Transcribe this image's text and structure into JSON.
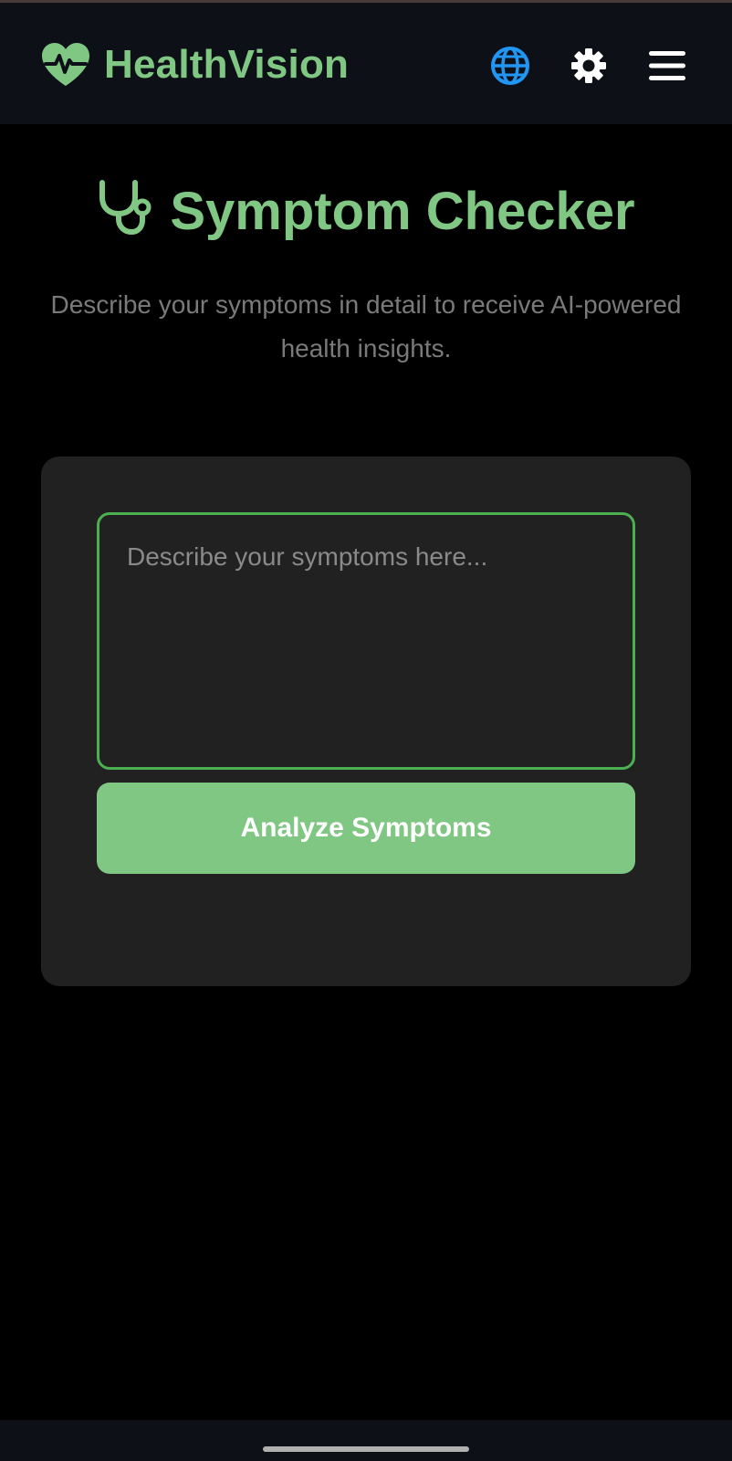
{
  "app": {
    "brand_name": "HealthVision",
    "brand_icon": "heart-pulse-icon",
    "accent_color": "#81c784",
    "header_bg": "#0d1117",
    "page_bg": "#000000"
  },
  "header": {
    "actions": [
      {
        "name": "language-button",
        "icon": "globe-icon",
        "color": "#2196f3"
      },
      {
        "name": "settings-button",
        "icon": "gear-icon",
        "color": "#ffffff"
      },
      {
        "name": "menu-button",
        "icon": "hamburger-menu-icon",
        "color": "#ffffff"
      }
    ]
  },
  "main": {
    "title": "Symptom Checker",
    "title_icon": "stethoscope-icon",
    "subtitle": "Describe your symptoms in detail to receive AI-powered health insights."
  },
  "form": {
    "symptoms_value": "",
    "symptoms_placeholder": "Describe your symptoms here...",
    "submit_label": "Analyze Symptoms",
    "input_border_color": "#4caf50",
    "button_color": "#81c784"
  }
}
